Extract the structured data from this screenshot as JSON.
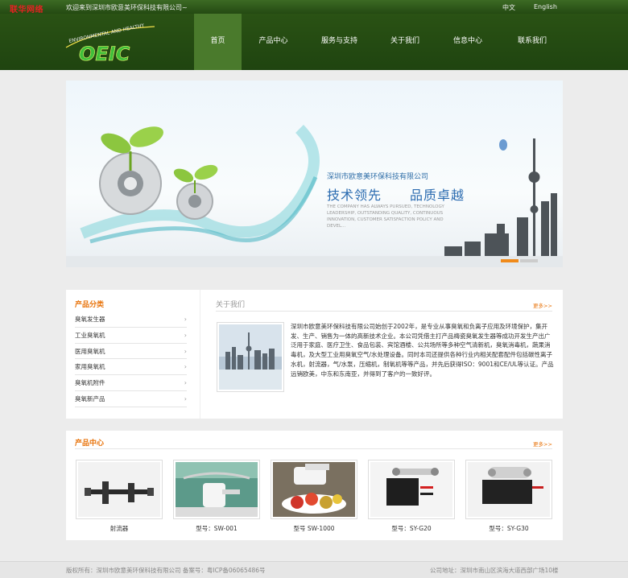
{
  "topbar": {
    "brand_tag": "联华网络",
    "welcome": "欢迎来到深圳市欧意美环保科技有限公司~",
    "lang_cn": "中文",
    "lang_en": "English"
  },
  "header": {
    "logo_tagline": "ENVIRONMENTAL AND HEALTHY",
    "logo_text": "OEIC",
    "nav": [
      {
        "label": "首页",
        "active": true
      },
      {
        "label": "产品中心",
        "active": false
      },
      {
        "label": "服务与支持",
        "active": false
      },
      {
        "label": "关于我们",
        "active": false
      },
      {
        "label": "信息中心",
        "active": false
      },
      {
        "label": "联系我们",
        "active": false
      }
    ]
  },
  "banner": {
    "company": "深圳市欧意美环保科技有限公司",
    "slogan1": "技术领先",
    "slogan2": "品质卓越",
    "en_text": "THE COMPANY HAS ALWAYS PURSUED, TECHNOLOGY LEADERSHIP, OUTSTANDING QUALITY, CONTINUOUS INNOVATION, CUSTOMER SATISFACTION POLICY AND DEVEL..."
  },
  "categories": {
    "title": "产品分类",
    "items": [
      "臭氧发生器",
      "工业臭氧机",
      "医用臭氧机",
      "家用臭氧机",
      "臭氧机附件",
      "臭氧新产品"
    ],
    "arrow": "›"
  },
  "about": {
    "title": "关于我们",
    "more": "更多>>",
    "text": "深圳市欧意美环保科技有限公司始创于2002年，是专业从事臭氧和负离子应用及环境保护，集开发、生产、销售为一体的高新技术企业。本公司凭借主打产品梅瓷臭氧发生器等成功开发生产出广泛用于家庭、医疗卫生、食品包装、宾馆酒楼、公共场所等多种空气清新机，臭氧消毒机，蔬果消毒机，及大型工业用臭氧空气/水处理设备。同时本司还提供各种行业内相关配套配件包括碳性离子水机，射流器，气/水泵，压缩机，制氧机等等产品，并先后获得ISO：9001和CE/UL等认证。产品远销欧美，中东和东南亚，并得到了客户的一致好评。"
  },
  "products": {
    "title": "产品中心",
    "more": "更多>>",
    "items": [
      {
        "label": "射流器"
      },
      {
        "label": "型号：SW-001"
      },
      {
        "label": "型号 SW-1000"
      },
      {
        "label": "型号：SY-G20"
      },
      {
        "label": "型号：SY-G30"
      }
    ]
  },
  "footer": {
    "copyright": "版权所有：深圳市欧意美环保科技有限公司 备案号：粤ICP备06065486号",
    "address": "公司地址：深圳市南山区滨海大道西部广场10楼"
  },
  "colors": {
    "header_green": "#244a12",
    "nav_active": "#4a7a2c",
    "accent_orange": "#e8740c",
    "banner_blue": "#2a6bb0"
  }
}
